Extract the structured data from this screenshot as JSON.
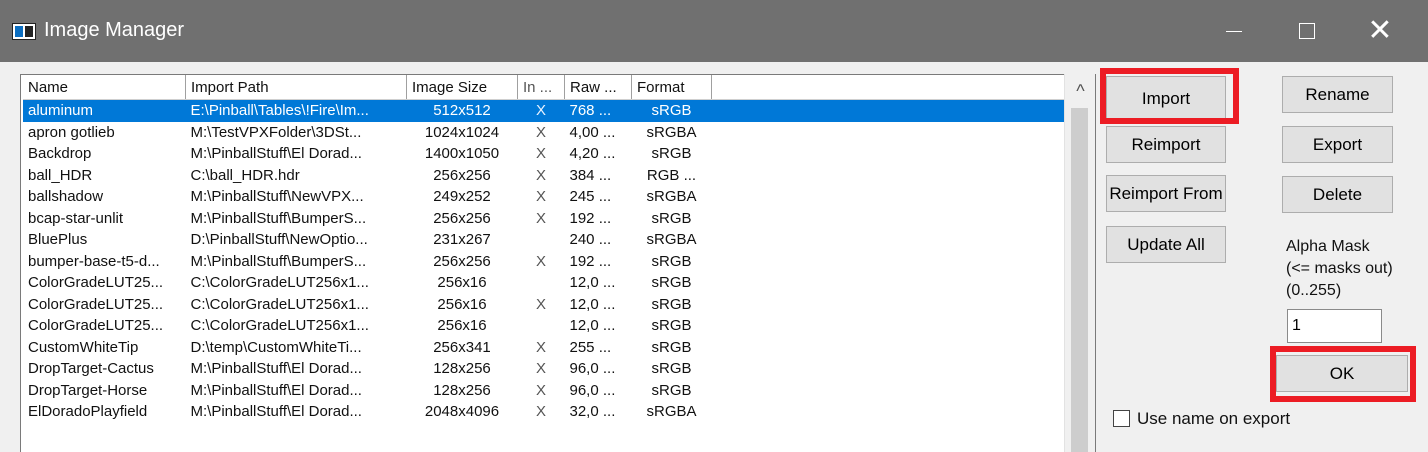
{
  "window": {
    "title": "Image Manager",
    "minimize_symbol": "—",
    "maximize_symbol": "□",
    "close_symbol": "✕"
  },
  "list": {
    "columns": [
      "Name",
      "Import Path",
      "Image Size",
      "In ...",
      "Raw ...",
      "Format"
    ],
    "rows": [
      {
        "name": "aluminum",
        "path": "E:\\Pinball\\Tables\\!Fire\\Im...",
        "size": "512x512",
        "in": "X",
        "raw": "768 ...",
        "format": "sRGB",
        "selected": true
      },
      {
        "name": "apron gotlieb",
        "path": "M:\\TestVPXFolder\\3DSt...",
        "size": "1024x1024",
        "in": "X",
        "raw": "4,00 ...",
        "format": "sRGBA"
      },
      {
        "name": "Backdrop",
        "path": "M:\\PinballStuff\\El Dorad...",
        "size": "1400x1050",
        "in": "X",
        "raw": "4,20 ...",
        "format": "sRGB"
      },
      {
        "name": "ball_HDR",
        "path": "C:\\ball_HDR.hdr",
        "size": "256x256",
        "in": "X",
        "raw": "384 ...",
        "format": "RGB ..."
      },
      {
        "name": "ballshadow",
        "path": "M:\\PinballStuff\\NewVPX...",
        "size": "249x252",
        "in": "X",
        "raw": "245 ...",
        "format": "sRGBA"
      },
      {
        "name": "bcap-star-unlit",
        "path": "M:\\PinballStuff\\BumperS...",
        "size": "256x256",
        "in": "X",
        "raw": "192 ...",
        "format": "sRGB"
      },
      {
        "name": "BluePlus",
        "path": "D:\\PinballStuff\\NewOptio...",
        "size": "231x267",
        "in": "",
        "raw": "240 ...",
        "format": "sRGBA"
      },
      {
        "name": "bumper-base-t5-d...",
        "path": "M:\\PinballStuff\\BumperS...",
        "size": "256x256",
        "in": "X",
        "raw": "192 ...",
        "format": "sRGB"
      },
      {
        "name": "ColorGradeLUT25...",
        "path": "C:\\ColorGradeLUT256x1...",
        "size": "256x16",
        "in": "",
        "raw": "12,0 ...",
        "format": "sRGB"
      },
      {
        "name": "ColorGradeLUT25...",
        "path": "C:\\ColorGradeLUT256x1...",
        "size": "256x16",
        "in": "X",
        "raw": "12,0 ...",
        "format": "sRGB"
      },
      {
        "name": "ColorGradeLUT25...",
        "path": "C:\\ColorGradeLUT256x1...",
        "size": "256x16",
        "in": "",
        "raw": "12,0 ...",
        "format": "sRGB"
      },
      {
        "name": "CustomWhiteTip",
        "path": "D:\\temp\\CustomWhiteTi...",
        "size": "256x341",
        "in": "X",
        "raw": "255 ...",
        "format": "sRGB"
      },
      {
        "name": "DropTarget-Cactus",
        "path": "M:\\PinballStuff\\El Dorad...",
        "size": "128x256",
        "in": "X",
        "raw": "96,0 ...",
        "format": "sRGB"
      },
      {
        "name": "DropTarget-Horse",
        "path": "M:\\PinballStuff\\El Dorad...",
        "size": "128x256",
        "in": "X",
        "raw": "96,0 ...",
        "format": "sRGB"
      },
      {
        "name": "ElDoradoPlayfield",
        "path": "M:\\PinballStuff\\El Dorad...",
        "size": "2048x4096",
        "in": "X",
        "raw": "32,0 ...",
        "format": "sRGBA"
      }
    ]
  },
  "buttons": {
    "import": "Import",
    "reimport": "Reimport",
    "reimport_from": "Reimport From",
    "update_all": "Update All",
    "rename": "Rename",
    "export": "Export",
    "delete": "Delete",
    "ok": "OK"
  },
  "alpha_mask": {
    "label_line1": "Alpha Mask",
    "label_line2": "(<= masks out)",
    "label_line3": "(0..255)",
    "value": "1"
  },
  "use_name_on_export": {
    "label": "Use name on export",
    "checked": false
  },
  "scrollbar": {
    "up_arrow": "^"
  },
  "colors": {
    "title_bar": "#707070",
    "selection": "#0078d7",
    "highlight": "#ec1c24"
  },
  "icons": [
    "app-icon",
    "minimize-icon",
    "maximize-icon",
    "close-icon",
    "scroll-up-icon",
    "checkbox-icon"
  ]
}
